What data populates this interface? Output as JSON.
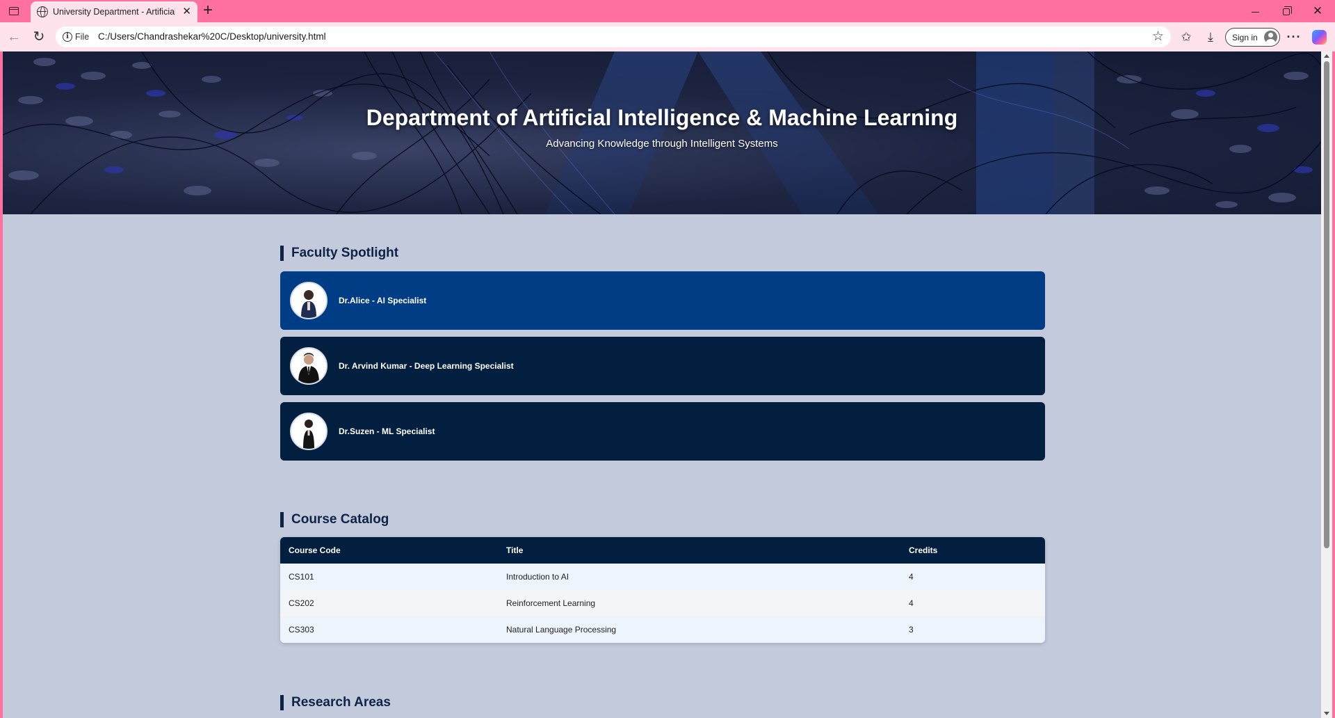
{
  "browser": {
    "tab_title": "University Department - Artificial Intelligence & Machine Learning",
    "address_scheme": "File",
    "address_url": "C:/Users/Chandrashekar%20C/Desktop/university.html",
    "signin_label": "Sign in",
    "icons": [
      "tab-actions-icon",
      "globe-icon",
      "close-icon",
      "plus-icon",
      "minimize-icon",
      "restore-icon",
      "back-icon",
      "refresh-icon",
      "info-icon",
      "star-icon",
      "favorites-icon",
      "download-icon",
      "avatar-icon",
      "more-icon",
      "copilot-icon"
    ]
  },
  "hero": {
    "title": "Department of Artificial Intelligence & Machine Learning",
    "subtitle": "Advancing Knowledge through Intelligent Systems"
  },
  "faculty": {
    "heading": "Faculty Spotlight",
    "members": [
      {
        "name": "Dr.Alice - AI Specialist",
        "active": true
      },
      {
        "name": "Dr. Arvind Kumar - Deep Learning Specialist",
        "active": false
      },
      {
        "name": "Dr.Suzen - ML Specialist",
        "active": false
      }
    ]
  },
  "courses": {
    "heading": "Course Catalog",
    "columns": [
      "Course Code",
      "Title",
      "Credits"
    ],
    "rows": [
      [
        "CS101",
        "Introduction to AI",
        "4"
      ],
      [
        "CS202",
        "Reinforcement Learning",
        "4"
      ],
      [
        "CS303",
        "Natural Language Processing",
        "3"
      ]
    ]
  },
  "research": {
    "heading": "Research Areas"
  },
  "colors": {
    "browser_frame": "#ff6f9f",
    "page_background": "#c2cadb",
    "navy": "#031f40",
    "active_card": "#003d85"
  }
}
